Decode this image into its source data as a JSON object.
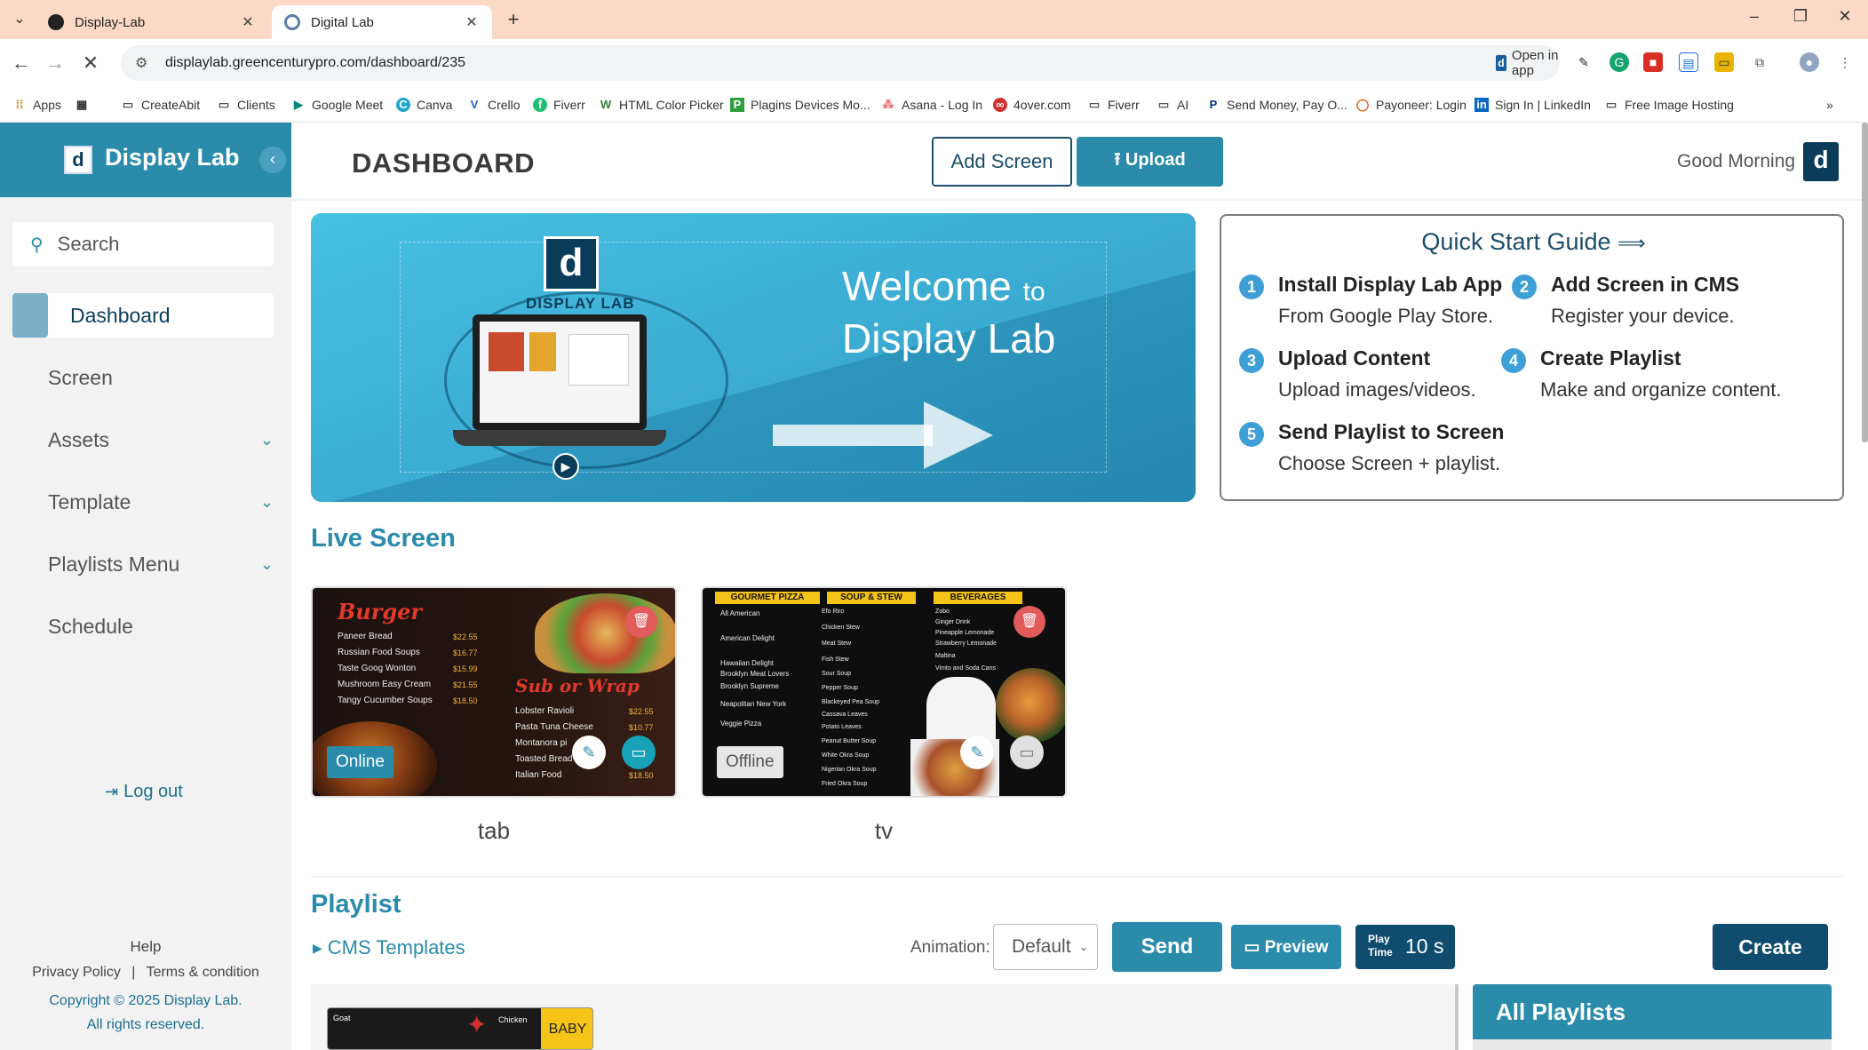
{
  "browser": {
    "tabs": [
      {
        "label": "Display-Lab",
        "active": false
      },
      {
        "label": "Digital Lab",
        "active": true
      }
    ],
    "url": "displaylab.greencenturypro.com/dashboard/235",
    "open_in_app": "Open in app",
    "bookmarks": [
      "Apps",
      "CreateAbit",
      "Clients",
      "Google Meet",
      "Canva",
      "Crello",
      "Fiverr",
      "HTML Color Picker",
      "Plagins Devices Mo...",
      "Asana - Log In",
      "4over.com",
      "Fiverr",
      "AI",
      "Send Money, Pay O...",
      "Payoneer: Login",
      "Sign In | LinkedIn",
      "Free Image Hosting"
    ]
  },
  "sidebar": {
    "brand": "Display Lab",
    "brand_logo": "d",
    "search_placeholder": "Search",
    "items": [
      {
        "label": "Dashboard",
        "active": true,
        "expandable": false
      },
      {
        "label": "Screen",
        "active": false,
        "expandable": false
      },
      {
        "label": "Assets",
        "active": false,
        "expandable": true
      },
      {
        "label": "Template",
        "active": false,
        "expandable": true
      },
      {
        "label": "Playlists Menu",
        "active": false,
        "expandable": true
      },
      {
        "label": "Schedule",
        "active": false,
        "expandable": false
      }
    ],
    "logout": "Log out",
    "help": "Help",
    "privacy": "Privacy Policy",
    "separator": "|",
    "terms": "Terms & condition",
    "copyright": "Copyright © 2025 Display Lab.",
    "rights": "All rights reserved."
  },
  "header": {
    "title": "DASHBOARD",
    "add_screen": "Add Screen",
    "upload": "Upload",
    "greeting": "Good Morning",
    "avatar": "d"
  },
  "banner": {
    "logo_letter": "d",
    "logo_text": "DISPLAY LAB",
    "welcome_big": "Welcome",
    "welcome_small": "to",
    "welcome_line2": "Display Lab"
  },
  "quick_start": {
    "title": "Quick Start Guide",
    "arrow": "⟹",
    "steps": [
      {
        "num": "1",
        "title": "Install Display Lab App",
        "desc": "From Google Play Store."
      },
      {
        "num": "2",
        "title": "Add Screen in CMS",
        "desc": "Register your device."
      },
      {
        "num": "3",
        "title": "Upload Content",
        "desc": "Upload images/videos."
      },
      {
        "num": "4",
        "title": "Create Playlist",
        "desc": "Make and organize content."
      },
      {
        "num": "5",
        "title": "Send Playlist to Screen",
        "desc": "Choose Screen + playlist."
      }
    ]
  },
  "live_screen": {
    "title": "Live Screen",
    "screens": [
      {
        "name": "tab",
        "status": "Online",
        "menu_title": "Burger",
        "menu_subtitle": "Sub or Wrap",
        "items": [
          "Paneer Bread",
          "Russian Food Soups",
          "Taste Goog Wonton",
          "Mushroom Easy Cream",
          "Tangy Cucumber Soups"
        ],
        "prices": [
          "$22.55",
          "$16.77",
          "$15.99",
          "$21.55",
          "$18.50"
        ],
        "items2": [
          "Lobster Ravioli",
          "Pasta Tuna Cheese",
          "Montanora pi",
          "Toasted Bread",
          "Italian Food"
        ],
        "prices2": [
          "$22.55",
          "$10.77",
          "",
          "",
          "$18.50"
        ]
      },
      {
        "name": "tv",
        "status": "Offline",
        "headings": [
          "GOURMET PIZZA",
          "SOUP & STEW",
          "BEVERAGES"
        ],
        "items": [
          "All American",
          "American Delight",
          "Hawaiian Delight",
          "Brooklyn Meat Lovers",
          "Brooklyn Supreme",
          "Neapolitan New York",
          "Veggie Pizza"
        ],
        "items2": [
          "Efo Riro",
          "Chicken Stew",
          "Meat Stew",
          "Fish Stew",
          "Sour Soup",
          "Pepper Soup",
          "Blackeyed Pea Soup",
          "Cassava Leaves",
          "Potato Leaves",
          "Peanut Butter Soup",
          "White Okra Soup",
          "Nigerian Okra Soup",
          "Fried Okra Soup"
        ],
        "items3": [
          "Zobo",
          "Ginger Drink",
          "Pineapple Lemonade",
          "Strawberry Lemonade",
          "Maltina",
          "Vimto and Soda Cans"
        ]
      }
    ]
  },
  "playlist": {
    "title": "Playlist",
    "cms_templates": "CMS Templates",
    "animation_label": "Animation:",
    "animation_value": "Default",
    "send": "Send",
    "preview": "Preview",
    "play_time_label": "Play Time",
    "play_time_value": "10 s",
    "create": "Create",
    "all_playlists": "All Playlists",
    "thumb_texts": [
      "Goat",
      "Chicken",
      "BABY"
    ]
  },
  "colors": {
    "brand": "#2a8bab",
    "dark": "#0f4c6e",
    "danger": "#e25b5b",
    "tabbar": "#fbd9c6"
  }
}
